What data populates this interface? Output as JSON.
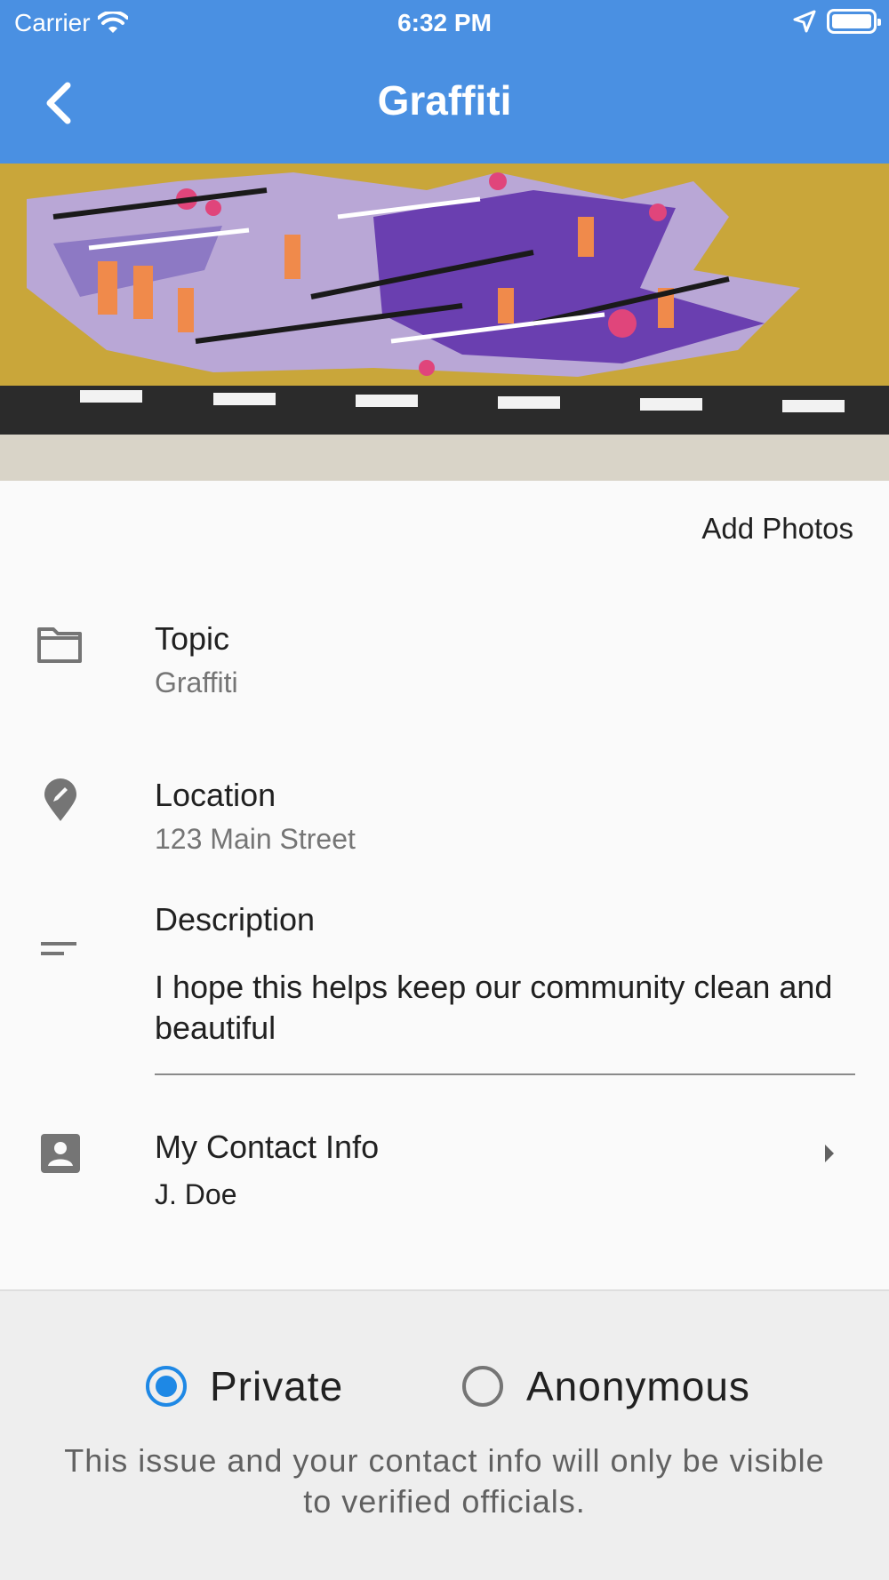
{
  "status_bar": {
    "carrier": "Carrier",
    "time": "6:32 PM"
  },
  "app_bar": {
    "title": "Graffiti",
    "color": "#4a90e2"
  },
  "actions": {
    "add_photos": "Add Photos"
  },
  "fields": {
    "topic": {
      "label": "Topic",
      "value": "Graffiti"
    },
    "location": {
      "label": "Location",
      "value": "123 Main Street"
    },
    "description": {
      "label": "Description",
      "value": "I hope this helps keep our community clean and beautiful"
    },
    "contact": {
      "label": "My Contact Info",
      "value": "J. Doe"
    }
  },
  "privacy": {
    "options": [
      {
        "label": "Private",
        "selected": true
      },
      {
        "label": "Anonymous",
        "selected": false
      }
    ],
    "note": "This issue and your contact info will only be visible to verified officials.",
    "accent": "#1e88e5"
  }
}
